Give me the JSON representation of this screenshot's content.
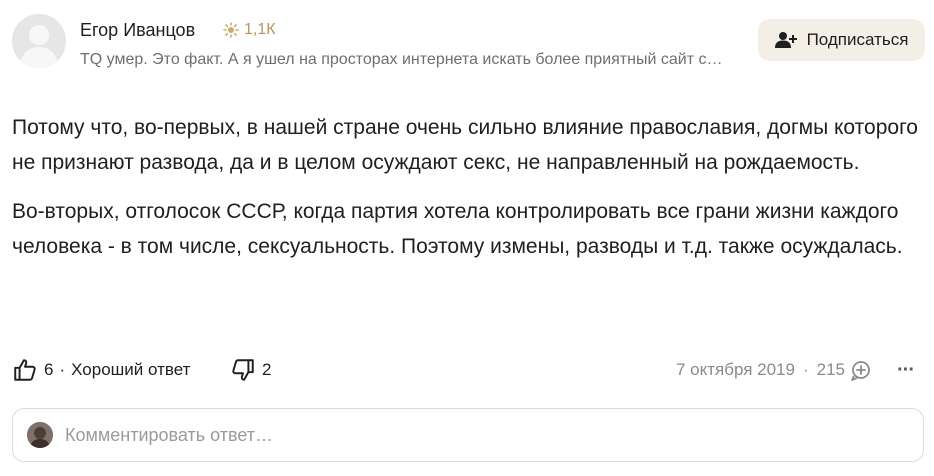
{
  "author": {
    "name": "Егор Иванцов",
    "karma": "1,1К",
    "bio": "TQ умер. Это факт. А я ушел на просторах интернета искать более приятный сайт с…"
  },
  "subscribe_label": "Подписаться",
  "answer": {
    "paragraphs": [
      "Потому что, во-первых, в нашей стране очень сильно влияние православия, догмы которого не признают развода, да и в целом осуждают секс, не направленный на рождаемость.",
      "Во-вторых, отголосок СССР, когда партия хотела контролировать все грани жизни каждого человека - в том числе, сексуальность. Поэтому измены, разводы и т.д. также осуждалась."
    ]
  },
  "actions": {
    "likes": "6",
    "dot": "·",
    "good_answer": "Хороший ответ",
    "dislikes": "2",
    "date": "7 октября 2019",
    "views": "215",
    "more": "···"
  },
  "comment": {
    "placeholder": "Комментировать ответ…"
  },
  "colors": {
    "karma": "#b59758",
    "subscribe_bg": "#f3efe6",
    "muted": "#8a8a8a"
  },
  "icons": [
    "karma-laurel-icon",
    "add-user-icon",
    "thumbs-up-icon",
    "thumbs-down-icon",
    "reply-bubble-icon",
    "more-dots-icon"
  ]
}
